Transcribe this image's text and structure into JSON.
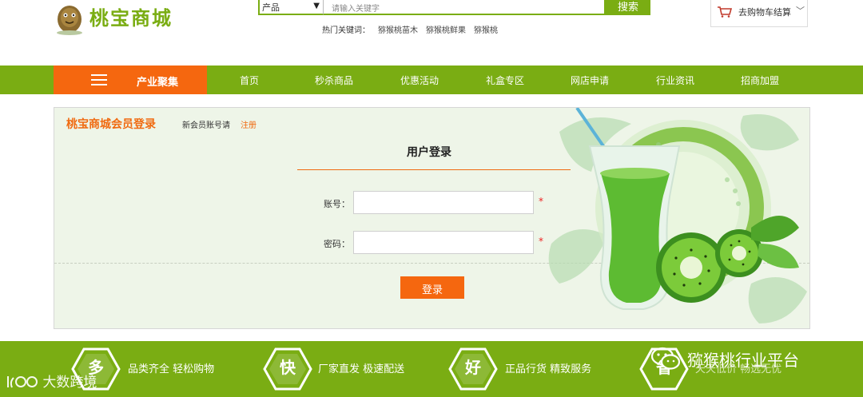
{
  "header": {
    "logo_text": "桃宝商城",
    "search": {
      "category": "产品",
      "placeholder": "请输入关键字",
      "button": "搜索"
    },
    "hot_keywords_label": "热门关键词：",
    "hot_keywords": [
      "猕猴桃苗木",
      "猕猴桃鲜果",
      "猕猴桃"
    ],
    "cart_label": "去购物车结算"
  },
  "nav": {
    "category_label": "产业聚集",
    "items": [
      "首页",
      "秒杀商品",
      "优惠活动",
      "礼盒专区",
      "网店申请",
      "行业资讯",
      "招商加盟"
    ]
  },
  "login": {
    "panel_title": "桃宝商城会员登录",
    "new_member_text": "新会员账号请",
    "register_link": "注册",
    "heading": "用户登录",
    "account_label": "账号：",
    "password_label": "密码：",
    "required_mark": "*",
    "submit": "登录"
  },
  "footer": {
    "features": [
      {
        "badge": "多",
        "text": "品类齐全 轻松购物"
      },
      {
        "badge": "快",
        "text": "厂家直发 极速配送"
      },
      {
        "badge": "好",
        "text": "正品行货 精致服务"
      },
      {
        "badge": "省",
        "text": "天天低价 畅选无忧"
      }
    ]
  },
  "watermarks": {
    "left": "大数跨境",
    "right": "猕猴桃行业平台"
  },
  "colors": {
    "brand_green": "#7aad13",
    "accent_orange": "#f5670f",
    "panel_bg": "#eef5e8"
  }
}
